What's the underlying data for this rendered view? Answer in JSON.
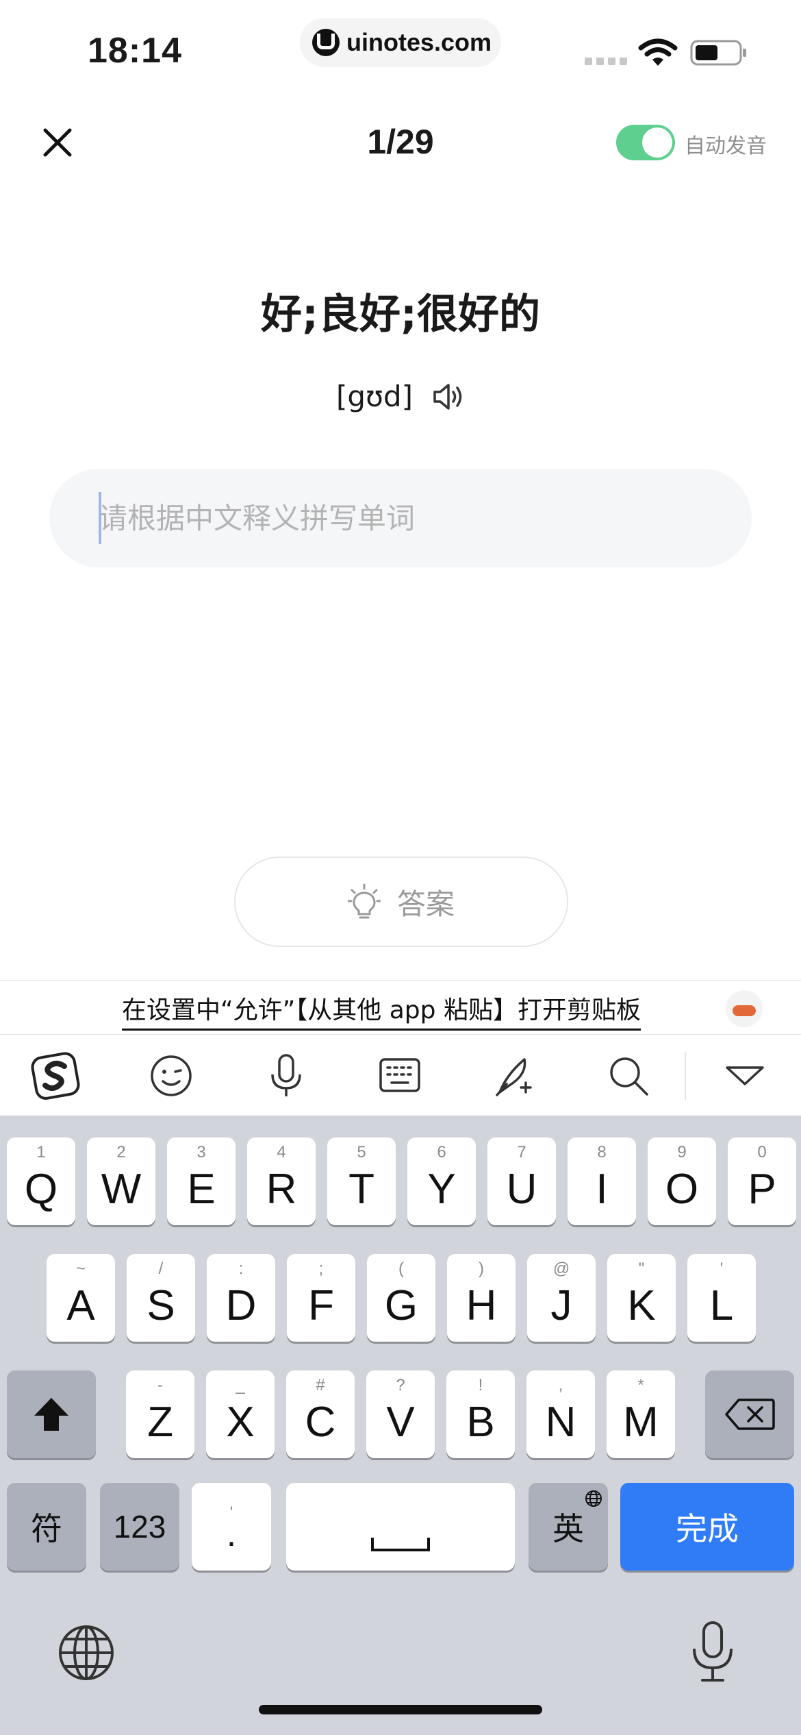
{
  "status_bar": {
    "time": "18:14",
    "url": "uinotes.com"
  },
  "header": {
    "progress": "1/29",
    "auto_speak_label": "自动发音",
    "auto_speak_on": true
  },
  "word": {
    "meaning": "好;良好;很好的",
    "phonetic": "[gʊd]"
  },
  "input": {
    "placeholder": "请根据中文释义拼写单词",
    "value": ""
  },
  "answer_label": "答案",
  "clipboard_hint": "在设置中“允许”【从其他 app 粘贴】打开剪贴板",
  "keyboard": {
    "row1": [
      {
        "k": "Q",
        "h": "1"
      },
      {
        "k": "W",
        "h": "2"
      },
      {
        "k": "E",
        "h": "3"
      },
      {
        "k": "R",
        "h": "4"
      },
      {
        "k": "T",
        "h": "5"
      },
      {
        "k": "Y",
        "h": "6"
      },
      {
        "k": "U",
        "h": "7"
      },
      {
        "k": "I",
        "h": "8"
      },
      {
        "k": "O",
        "h": "9"
      },
      {
        "k": "P",
        "h": "0"
      }
    ],
    "row2": [
      {
        "k": "A",
        "h": "~"
      },
      {
        "k": "S",
        "h": "/"
      },
      {
        "k": "D",
        "h": ":"
      },
      {
        "k": "F",
        "h": ";"
      },
      {
        "k": "G",
        "h": "("
      },
      {
        "k": "H",
        "h": ")"
      },
      {
        "k": "J",
        "h": "@"
      },
      {
        "k": "K",
        "h": "\""
      },
      {
        "k": "L",
        "h": "'"
      }
    ],
    "row3": [
      {
        "k": "Z",
        "h": "-"
      },
      {
        "k": "X",
        "h": "_"
      },
      {
        "k": "C",
        "h": "#"
      },
      {
        "k": "V",
        "h": "?"
      },
      {
        "k": "B",
        "h": "!"
      },
      {
        "k": "N",
        "h": ","
      },
      {
        "k": "M",
        "h": "*"
      }
    ],
    "symbols_label": "符",
    "numbers_label": "123",
    "punct_label": ".",
    "punct_hint": "'",
    "lang_label": "英",
    "done_label": "完成"
  },
  "colors": {
    "accent_blue": "#2f7cf6",
    "toggle_green": "#5fcf8f"
  }
}
